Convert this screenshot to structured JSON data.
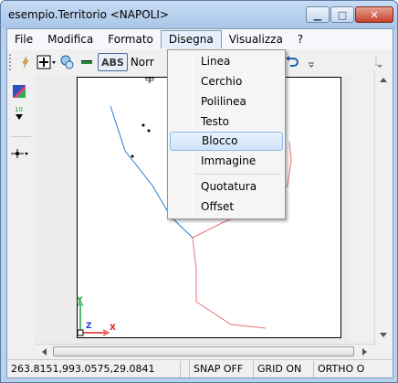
{
  "window": {
    "title": "esempio.Territorio <NAPOLI>",
    "minimize_glyph": "▁",
    "maximize_glyph": "□",
    "close_glyph": "✕"
  },
  "menubar": {
    "items": [
      "File",
      "Modifica",
      "Formato",
      "Disegna",
      "Visualizza",
      "?"
    ],
    "open_menu": "Disegna"
  },
  "toolbar": {
    "abs_label": "ABS",
    "line_style_value": "Norr",
    "icons": [
      "snap-icon",
      "point-style-icon",
      "layers-icon",
      "line-icon",
      "undo-icon"
    ]
  },
  "dropdown": {
    "items": [
      {
        "label": "Linea"
      },
      {
        "label": "Cerchio"
      },
      {
        "label": "Polilinea"
      },
      {
        "label": "Testo"
      },
      {
        "label": "Blocco",
        "highlighted": true
      },
      {
        "label": "Immagine"
      },
      {
        "label": "Quotatura"
      },
      {
        "label": "Offset"
      }
    ]
  },
  "axis_indicator": {
    "y_label": "Y",
    "z_label": "Z",
    "x_label": "X"
  },
  "statusbar": {
    "coordinates": "263.8151,993.0575,29.0841",
    "snap": "SNAP OFF",
    "grid": "GRID ON",
    "ortho": "ORTHO O"
  },
  "colors": {
    "blue_line": "#1f7fd6",
    "red_line": "#e87070",
    "highlight": "#cde3fb"
  }
}
